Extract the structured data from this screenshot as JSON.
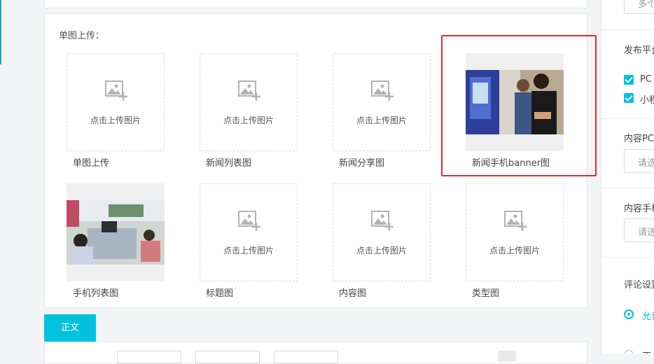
{
  "section_title": "单图上传：",
  "upload_hint": "点击上传图片",
  "tiles": [
    {
      "label": "单图上传",
      "state": "empty"
    },
    {
      "label": "新闻列表图",
      "state": "empty"
    },
    {
      "label": "新闻分享图",
      "state": "empty"
    },
    {
      "label": "新闻手机banner图",
      "state": "image",
      "highlighted": true
    },
    {
      "label": "手机列表图",
      "state": "image"
    },
    {
      "label": "标题图",
      "state": "empty"
    },
    {
      "label": "内容图",
      "state": "empty"
    },
    {
      "label": "类型图",
      "state": "empty"
    }
  ],
  "editor_tabs": [
    "正文"
  ],
  "right_panel": {
    "top_input_text": "多个",
    "publish_platform_label": "发布平台",
    "platforms": [
      {
        "label": "PC",
        "checked": true
      },
      {
        "label": "小程",
        "checked": true
      }
    ],
    "content_pc_label": "内容PC",
    "content_pc_placeholder": "请选",
    "content_mobile_label": "内容手机",
    "content_mobile_placeholder": "请选",
    "comment_settings_label": "评论设置",
    "comment_options": [
      {
        "label": "允许",
        "selected": true
      },
      {
        "label": "不允",
        "selected": false
      }
    ]
  },
  "colors": {
    "accent": "#00c1de",
    "highlight": "#e22b2b",
    "left_accent": "#1ba7b3"
  }
}
